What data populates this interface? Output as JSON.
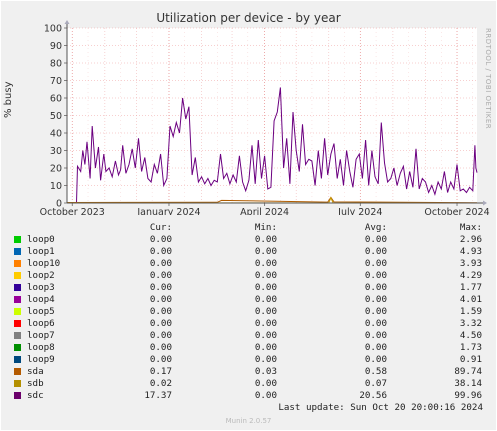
{
  "chart_data": {
    "type": "line",
    "title": "Utilization per device - by year",
    "ylabel": "% busy",
    "ylim": [
      0,
      100
    ],
    "yticks": [
      0,
      10,
      20,
      30,
      40,
      50,
      60,
      70,
      80,
      90,
      100
    ],
    "xlim": [
      "2023-09-26",
      "2024-10-20"
    ],
    "xticks": [
      {
        "label": "October 2023",
        "date": "2023-10-01"
      },
      {
        "label": "January 2024",
        "date": "2024-01-01"
      },
      {
        "label": "April 2024",
        "date": "2024-04-01"
      },
      {
        "label": "July 2024",
        "date": "2024-07-01"
      },
      {
        "label": "October 2024",
        "date": "2024-10-01"
      }
    ],
    "grid": true,
    "series": [
      {
        "name": "sdc",
        "color": "#6b0080",
        "x": [
          "2023-09-26",
          "2023-10-05",
          "2023-10-06",
          "2023-10-09",
          "2023-10-11",
          "2023-10-13",
          "2023-10-15",
          "2023-10-18",
          "2023-10-20",
          "2023-10-23",
          "2023-10-26",
          "2023-10-28",
          "2023-10-31",
          "2023-11-02",
          "2023-11-05",
          "2023-11-08",
          "2023-11-11",
          "2023-11-14",
          "2023-11-16",
          "2023-11-18",
          "2023-11-21",
          "2023-11-24",
          "2023-11-27",
          "2023-11-30",
          "2023-12-03",
          "2023-12-06",
          "2023-12-09",
          "2023-12-12",
          "2023-12-15",
          "2023-12-18",
          "2023-12-21",
          "2023-12-24",
          "2023-12-27",
          "2023-12-30",
          "2024-01-02",
          "2024-01-05",
          "2024-01-08",
          "2024-01-11",
          "2024-01-14",
          "2024-01-17",
          "2024-01-20",
          "2024-01-23",
          "2024-01-26",
          "2024-01-29",
          "2024-02-01",
          "2024-02-04",
          "2024-02-07",
          "2024-02-10",
          "2024-02-13",
          "2024-02-16",
          "2024-02-19",
          "2024-02-22",
          "2024-02-25",
          "2024-02-28",
          "2024-03-02",
          "2024-03-05",
          "2024-03-08",
          "2024-03-11",
          "2024-03-14",
          "2024-03-17",
          "2024-03-20",
          "2024-03-23",
          "2024-03-26",
          "2024-03-29",
          "2024-04-01",
          "2024-04-04",
          "2024-04-07",
          "2024-04-10",
          "2024-04-13",
          "2024-04-16",
          "2024-04-19",
          "2024-04-22",
          "2024-04-25",
          "2024-04-28",
          "2024-05-01",
          "2024-05-04",
          "2024-05-07",
          "2024-05-10",
          "2024-05-13",
          "2024-05-16",
          "2024-05-19",
          "2024-05-22",
          "2024-05-25",
          "2024-05-28",
          "2024-05-31",
          "2024-06-03",
          "2024-06-06",
          "2024-06-09",
          "2024-06-12",
          "2024-06-15",
          "2024-06-18",
          "2024-06-21",
          "2024-06-24",
          "2024-06-27",
          "2024-06-30",
          "2024-07-03",
          "2024-07-06",
          "2024-07-09",
          "2024-07-12",
          "2024-07-15",
          "2024-07-18",
          "2024-07-21",
          "2024-07-24",
          "2024-07-27",
          "2024-07-30",
          "2024-08-02",
          "2024-08-05",
          "2024-08-08",
          "2024-08-11",
          "2024-08-14",
          "2024-08-17",
          "2024-08-20",
          "2024-08-23",
          "2024-08-26",
          "2024-08-29",
          "2024-09-01",
          "2024-09-04",
          "2024-09-07",
          "2024-09-10",
          "2024-09-13",
          "2024-09-16",
          "2024-09-19",
          "2024-09-22",
          "2024-09-25",
          "2024-09-28",
          "2024-10-01",
          "2024-10-04",
          "2024-10-07",
          "2024-10-10",
          "2024-10-13",
          "2024-10-16",
          "2024-10-18",
          "2024-10-19",
          "2024-10-20"
        ],
        "values": [
          0,
          0,
          21,
          18,
          30,
          22,
          35,
          14,
          44,
          20,
          32,
          13,
          28,
          18,
          20,
          15,
          24,
          16,
          19,
          33,
          17,
          22,
          31,
          20,
          37,
          18,
          26,
          14,
          12,
          22,
          17,
          28,
          10,
          14,
          44,
          38,
          46,
          40,
          60,
          48,
          55,
          16,
          26,
          12,
          15,
          11,
          14,
          10,
          13,
          12,
          28,
          14,
          17,
          11,
          16,
          12,
          27,
          12,
          7,
          13,
          33,
          11,
          36,
          14,
          27,
          8,
          9,
          47,
          52,
          66,
          20,
          37,
          11,
          52,
          30,
          18,
          45,
          22,
          25,
          24,
          10,
          30,
          14,
          37,
          16,
          28,
          34,
          14,
          25,
          10,
          30,
          18,
          9,
          25,
          28,
          14,
          36,
          10,
          30,
          15,
          11,
          46,
          23,
          12,
          14,
          20,
          10,
          17,
          21,
          8,
          18,
          9,
          31,
          8,
          14,
          12,
          6,
          10,
          5,
          12,
          8,
          18,
          6,
          12,
          8,
          22,
          7,
          8,
          6,
          9,
          7,
          33,
          20,
          17.37
        ]
      },
      {
        "name": "sda",
        "color": "#b05c00",
        "x": [
          "2023-09-26",
          "2024-02-16",
          "2024-02-20",
          "2024-05-31",
          "2024-06-03",
          "2024-06-06",
          "2024-10-20"
        ],
        "values": [
          0.3,
          0.4,
          1.5,
          0.5,
          3.2,
          0.6,
          0.17
        ]
      },
      {
        "name": "sdb",
        "color": "#c79b00",
        "x": [
          "2023-09-26",
          "2024-06-01",
          "2024-06-03",
          "2024-06-05",
          "2024-10-20"
        ],
        "values": [
          0.05,
          0.1,
          3,
          0.1,
          0.02
        ]
      }
    ]
  },
  "legend": {
    "headers": {
      "cur": "Cur:",
      "min": "Min:",
      "avg": "Avg:",
      "max": "Max:"
    },
    "rows": [
      {
        "name": "loop0",
        "color": "#00cc00",
        "cur": "0.00",
        "min": "0.00",
        "avg": "0.00",
        "max": "2.96"
      },
      {
        "name": "loop1",
        "color": "#0066b3",
        "cur": "0.00",
        "min": "0.00",
        "avg": "0.00",
        "max": "4.93"
      },
      {
        "name": "loop10",
        "color": "#ff8000",
        "cur": "0.00",
        "min": "0.00",
        "avg": "0.00",
        "max": "3.93"
      },
      {
        "name": "loop2",
        "color": "#ffcc00",
        "cur": "0.00",
        "min": "0.00",
        "avg": "0.00",
        "max": "4.29"
      },
      {
        "name": "loop3",
        "color": "#330099",
        "cur": "0.00",
        "min": "0.00",
        "avg": "0.00",
        "max": "1.77"
      },
      {
        "name": "loop4",
        "color": "#990099",
        "cur": "0.00",
        "min": "0.00",
        "avg": "0.00",
        "max": "4.01"
      },
      {
        "name": "loop5",
        "color": "#ccff00",
        "cur": "0.00",
        "min": "0.00",
        "avg": "0.00",
        "max": "1.59"
      },
      {
        "name": "loop6",
        "color": "#ff0000",
        "cur": "0.00",
        "min": "0.00",
        "avg": "0.00",
        "max": "3.32"
      },
      {
        "name": "loop7",
        "color": "#808080",
        "cur": "0.00",
        "min": "0.00",
        "avg": "0.00",
        "max": "4.50"
      },
      {
        "name": "loop8",
        "color": "#008f00",
        "cur": "0.00",
        "min": "0.00",
        "avg": "0.00",
        "max": "1.73"
      },
      {
        "name": "loop9",
        "color": "#00487d",
        "cur": "0.00",
        "min": "0.00",
        "avg": "0.00",
        "max": "0.91"
      },
      {
        "name": "sda",
        "color": "#b35a00",
        "cur": "0.17",
        "min": "0.03",
        "avg": "0.58",
        "max": "89.74"
      },
      {
        "name": "sdb",
        "color": "#b38f00",
        "cur": "0.02",
        "min": "0.00",
        "avg": "0.07",
        "max": "38.14"
      },
      {
        "name": "sdc",
        "color": "#6b006b",
        "cur": "17.37",
        "min": "0.00",
        "avg": "20.56",
        "max": "99.96"
      }
    ]
  },
  "footer": {
    "last_update": "Last update: Sun Oct 20 20:00:16 2024",
    "version": "Munin 2.0.57"
  },
  "watermark": "RRDTOOL / TOBI OETIKER"
}
